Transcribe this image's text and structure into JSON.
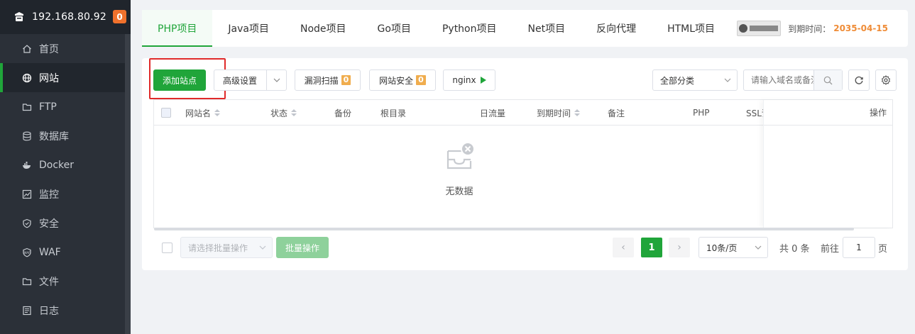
{
  "sidebar": {
    "host": "192.168.80.92",
    "badge": "0",
    "items": [
      {
        "label": "首页",
        "icon": "home-icon"
      },
      {
        "label": "网站",
        "icon": "globe-icon"
      },
      {
        "label": "FTP",
        "icon": "ftp-icon"
      },
      {
        "label": "数据库",
        "icon": "database-icon"
      },
      {
        "label": "Docker",
        "icon": "docker-icon"
      },
      {
        "label": "监控",
        "icon": "monitor-icon"
      },
      {
        "label": "安全",
        "icon": "shield-icon"
      },
      {
        "label": "WAF",
        "icon": "waf-icon"
      },
      {
        "label": "文件",
        "icon": "folder-icon"
      },
      {
        "label": "日志",
        "icon": "log-icon"
      }
    ],
    "active_index": 1
  },
  "tabs": [
    {
      "label": "PHP项目"
    },
    {
      "label": "Java项目"
    },
    {
      "label": "Node项目"
    },
    {
      "label": "Go项目"
    },
    {
      "label": "Python项目"
    },
    {
      "label": "Net项目"
    },
    {
      "label": "反向代理"
    },
    {
      "label": "HTML项目"
    }
  ],
  "expire": {
    "label": "到期时间：",
    "date": "2035-04-15"
  },
  "toolbar": {
    "add_site": "添加站点",
    "advanced": "高级设置",
    "vuln_scan": "漏洞扫描",
    "vuln_count": "0",
    "site_security": "网站安全",
    "security_count": "0",
    "nginx": "nginx",
    "category": "全部分类",
    "search_placeholder": "请输入域名或备注"
  },
  "table": {
    "columns": {
      "name": "网站名",
      "status": "状态",
      "backup": "备份",
      "root": "根目录",
      "traffic": "日流量",
      "expire": "到期时间",
      "remark": "备注",
      "php": "PHP",
      "ssl": "SSL证书",
      "actions": "操作"
    },
    "empty_text": "无数据"
  },
  "footer": {
    "batch_placeholder": "请选择批量操作",
    "batch_button": "批量操作",
    "current_page": "1",
    "page_size": "10条/页",
    "total": "共 0 条",
    "goto_prefix": "前往",
    "goto_value": "1",
    "goto_suffix": "页"
  },
  "colors": {
    "accent": "#20a53a",
    "sidebar": "#2b3038",
    "badge": "#f0712c",
    "highlight": "#e02a2a"
  }
}
